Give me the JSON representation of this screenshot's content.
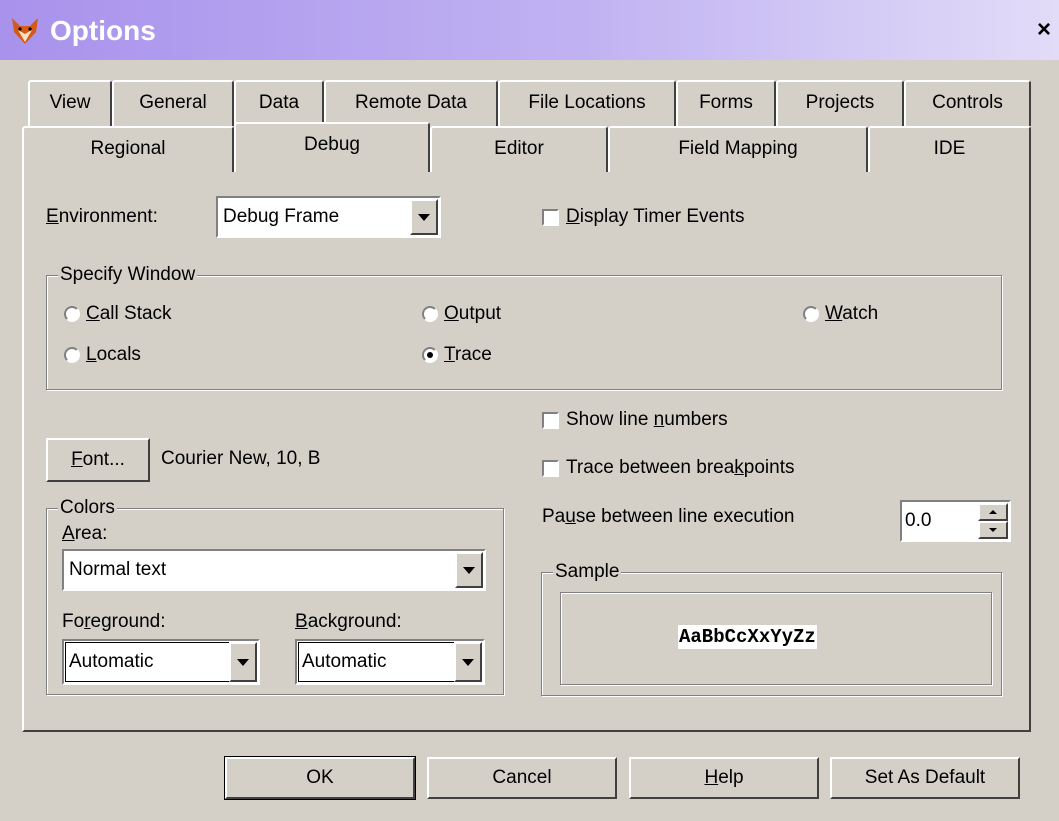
{
  "window": {
    "title": "Options",
    "close_glyph": "×",
    "app_icon": "fox-icon"
  },
  "tabs_row1": [
    "View",
    "General",
    "Data",
    "Remote Data",
    "File Locations",
    "Forms",
    "Projects",
    "Controls"
  ],
  "tabs_row2": [
    "Regional",
    "Debug",
    "Editor",
    "Field Mapping",
    "IDE"
  ],
  "active_tab": "Debug",
  "debug": {
    "environment_label": {
      "pre": "",
      "key": "E",
      "post": "nvironment:"
    },
    "environment_value": "Debug Frame",
    "display_timer_events": {
      "pre": "",
      "key": "D",
      "post": "isplay Timer Events",
      "checked": false
    },
    "specify_window": {
      "legend": "Specify Window",
      "options": [
        {
          "pre": "",
          "key": "C",
          "post": "all Stack",
          "selected": false
        },
        {
          "pre": "",
          "key": "O",
          "post": "utput",
          "selected": false
        },
        {
          "pre": "",
          "key": "W",
          "post": "atch",
          "selected": false
        },
        {
          "pre": "",
          "key": "L",
          "post": "ocals",
          "selected": false
        },
        {
          "pre": "",
          "key": "T",
          "post": "race",
          "selected": true
        }
      ]
    },
    "show_line_numbers": {
      "pre": "Show line ",
      "key": "n",
      "post": "umbers",
      "checked": false
    },
    "trace_between_breakpoints": {
      "pre": "Trace between brea",
      "key": "k",
      "post": "points",
      "checked": false
    },
    "font_button": {
      "pre": "",
      "key": "F",
      "post": "ont..."
    },
    "font_description": "Courier New, 10, B",
    "pause_label": {
      "pre": "Pa",
      "key": "u",
      "post": "se between line execution"
    },
    "pause_value": "0.0",
    "colors": {
      "legend": "Colors",
      "area_label": {
        "pre": "",
        "key": "A",
        "post": "rea:"
      },
      "area_value": "Normal text",
      "foreground_label": {
        "pre": "Fo",
        "key": "r",
        "post": "eground:"
      },
      "foreground_value": "Automatic",
      "background_label": {
        "pre": "",
        "key": "B",
        "post": "ackground:"
      },
      "background_value": "Automatic"
    },
    "sample": {
      "legend": "Sample",
      "text": "AaBbCcXxYyZz"
    }
  },
  "buttons": {
    "ok": {
      "pre": "OK",
      "key": "",
      "post": ""
    },
    "cancel": {
      "pre": "Cancel",
      "key": "",
      "post": ""
    },
    "help": {
      "pre": "",
      "key": "H",
      "post": "elp"
    },
    "set_default": {
      "pre": "Set As Default",
      "key": "",
      "post": ""
    }
  }
}
